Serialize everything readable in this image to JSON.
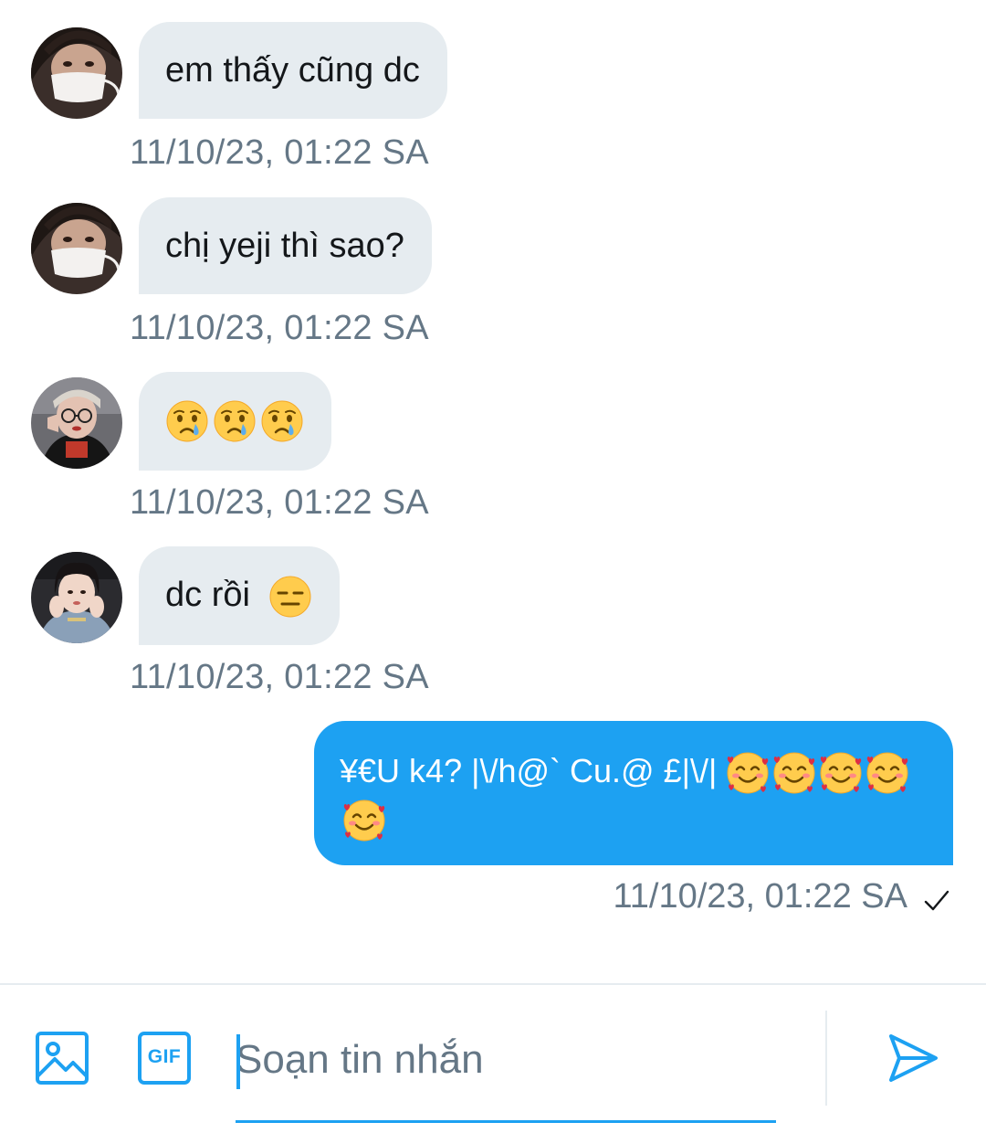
{
  "messages": [
    {
      "side": "in",
      "avatar": "avatar-girl-mask",
      "text": "em thấy cũng dc",
      "emojis": [],
      "time": "11/10/23, 01:22 SA"
    },
    {
      "side": "in",
      "avatar": "avatar-girl-mask",
      "text": "chị yeji thì sao?",
      "emojis": [],
      "time": "11/10/23, 01:22 SA"
    },
    {
      "side": "in",
      "avatar": "avatar-girl-glasses",
      "text": "",
      "emojis": [
        "crying-face",
        "crying-face",
        "crying-face"
      ],
      "time": "11/10/23, 01:22 SA"
    },
    {
      "side": "in",
      "avatar": "avatar-girl-hoodie",
      "text": "dc rồi",
      "emojis": [
        "expressionless-face"
      ],
      "time": "11/10/23, 01:22 SA"
    }
  ],
  "sent": {
    "text": "¥€U k4? |\\/h@` Cu.@ £|\\/|",
    "emojis": [
      "smiling-face-with-hearts",
      "smiling-face-with-hearts",
      "smiling-face-with-hearts",
      "smiling-face-with-hearts",
      "smiling-face-with-hearts"
    ],
    "time": "11/10/23, 01:22 SA",
    "status": "sent-check"
  },
  "composer": {
    "placeholder": "Soạn tin nhắn",
    "value": "",
    "image_icon": "image-icon",
    "gif_label": "GIF",
    "send_icon": "send-icon"
  },
  "colors": {
    "accent": "#1da1f2",
    "bubble_in": "#e6ecf0",
    "timestamp": "#657786"
  }
}
